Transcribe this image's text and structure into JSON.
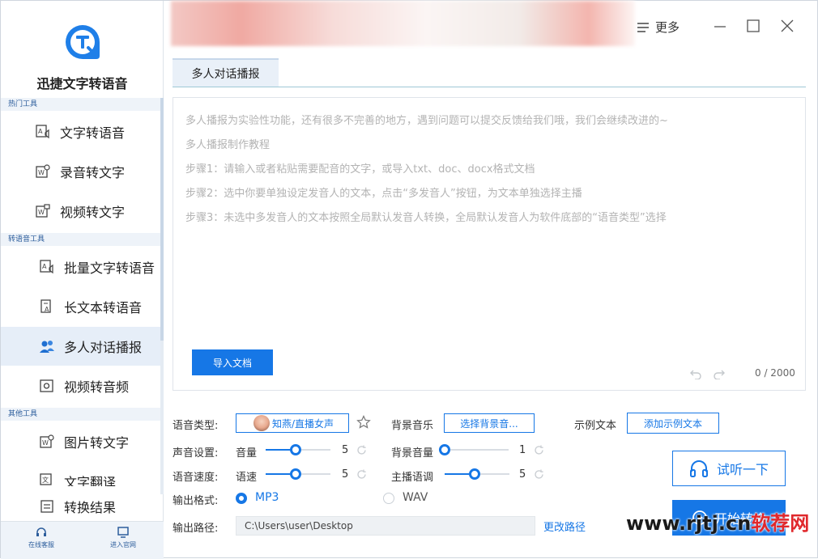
{
  "app": {
    "name": "迅捷文字转语音"
  },
  "sidebar": {
    "sections": [
      {
        "label": "热门工具"
      },
      {
        "label": "转语音工具"
      },
      {
        "label": "其他工具"
      }
    ],
    "items": [
      {
        "label": "文字转语音",
        "icon": "text-to-speech-icon"
      },
      {
        "label": "录音转文字",
        "icon": "audio-to-text-icon"
      },
      {
        "label": "视频转文字",
        "icon": "video-to-text-icon"
      },
      {
        "label": "批量文字转语音",
        "icon": "batch-text-icon"
      },
      {
        "label": "长文本转语音",
        "icon": "long-text-icon"
      },
      {
        "label": "多人对话播报",
        "icon": "multi-person-icon",
        "active": true
      },
      {
        "label": "视频转音频",
        "icon": "video-to-audio-icon"
      },
      {
        "label": "图片转文字",
        "icon": "image-to-text-icon"
      },
      {
        "label": "文字翻译",
        "icon": "translate-icon"
      },
      {
        "label": "转换结果",
        "icon": "result-icon"
      }
    ],
    "bottom": [
      {
        "label": "在线客服",
        "icon": "headset-icon"
      },
      {
        "label": "进入官网",
        "icon": "monitor-icon"
      }
    ]
  },
  "header": {
    "more_label": "更多"
  },
  "tab": {
    "label": "多人对话播报"
  },
  "editor": {
    "lines": [
      "多人播报为实验性功能，还有很多不完善的地方，遇到问题可以提交反馈给我们哦，我们会继续改进的~",
      "多人播报制作教程",
      "步骤1：请输入或者粘贴需要配音的文字，或导入txt、doc、docx格式文档",
      "步骤2：选中你要单独设定发音人的文本，点击“多发音人”按钮，为文本单独选择主播",
      "步骤3：未选中多发音人的文本按照全局默认发音人转换，全局默认发音人为软件底部的“语音类型”选择"
    ],
    "import_label": "导入文档",
    "counter": "0 / 2000"
  },
  "settings": {
    "voice_type_label": "语音类型:",
    "voice_name": "知燕/直播女声",
    "bg_music_label": "背景音乐",
    "bg_music_btn": "选择背景音...",
    "sample_text_label": "示例文本",
    "sample_text_btn": "添加示例文本",
    "sound_label": "声音设置:",
    "volume_label": "音量",
    "volume_value": "5",
    "volume_level": 0.45,
    "bg_volume_label": "背景音量",
    "bg_volume_value": "1",
    "bg_volume_level": 0.0,
    "speed_section_label": "语音速度:",
    "speed_label": "语速",
    "speed_value": "5",
    "speed_level": 0.45,
    "tone_label": "主播语调",
    "tone_value": "5",
    "tone_level": 0.45,
    "format_label": "输出格式:",
    "format_mp3": "MP3",
    "format_wav": "WAV",
    "format_selected": "MP3",
    "path_label": "输出路径:",
    "path_value": "C:\\Users\\user\\Desktop",
    "change_path": "更改路径",
    "listen_btn": "试听一下",
    "start_btn": "开始转换"
  },
  "watermark": {
    "part1": "www.rjtj.cn",
    "part2": "软荐网"
  },
  "colors": {
    "accent": "#1677e6",
    "sidebar_active": "#e6eef8",
    "section_bg": "#eef3f9"
  }
}
